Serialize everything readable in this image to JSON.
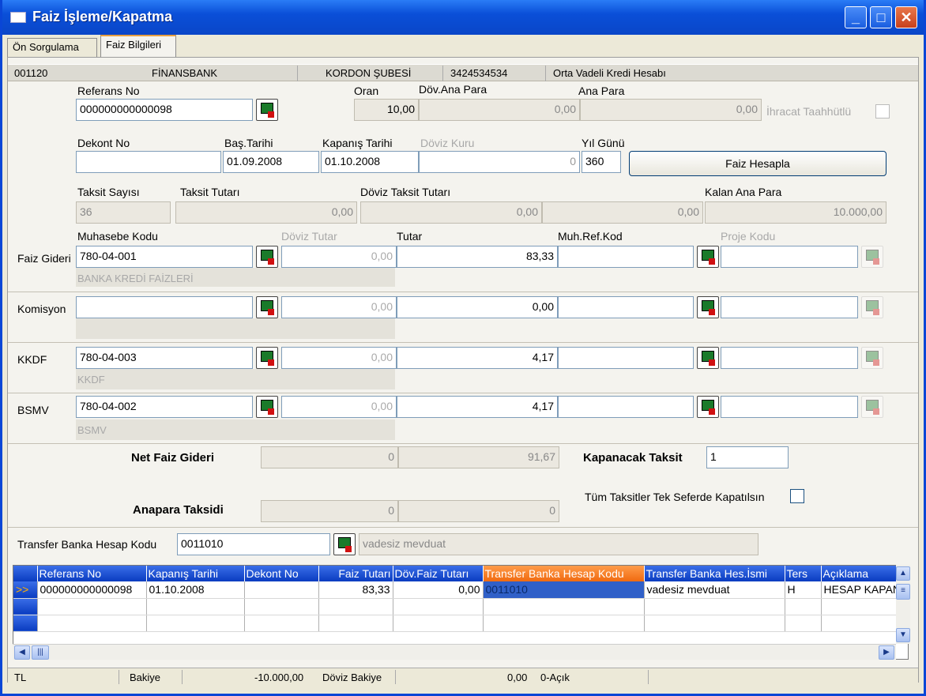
{
  "window": {
    "title": "Faiz İşleme/Kapatma"
  },
  "tabs": [
    "Ön Sorgulama",
    "Faiz Bilgileri"
  ],
  "info": {
    "code": "001120",
    "bank": "FİNANSBANK",
    "branch": "KORDON ŞUBESİ",
    "account": "3424534534",
    "account_type": "Orta Vadeli Kredi Hesabı"
  },
  "labels": {
    "referans_no": "Referans No",
    "oran": "Oran",
    "dov_ana_para": "Döv.Ana Para",
    "ana_para": "Ana Para",
    "ihracat": "İhracat Taahhütlü",
    "dekont_no": "Dekont No",
    "bas_tarihi": "Baş.Tarihi",
    "kapanis_tarihi": "Kapanış Tarihi",
    "doviz_kuru": "Döviz Kuru",
    "yil_gunu": "Yıl Günü",
    "taksit_sayisi": "Taksit Sayısı",
    "taksit_tutari": "Taksit Tutarı",
    "doviz_taksit_tutari": "Döviz Taksit Tutarı",
    "kalan_ana_para": "Kalan Ana Para",
    "muhasebe_kodu": "Muhasebe Kodu",
    "doviz_tutar": "Döviz Tutar",
    "tutar": "Tutar",
    "muh_ref_kod": "Muh.Ref.Kod",
    "proje_kodu": "Proje Kodu",
    "net_faiz_gideri": "Net Faiz Gideri",
    "kapanacak_taksit": "Kapanacak Taksit",
    "tum_taksitler": "Tüm Taksitler Tek Seferde Kapatılsın",
    "anapara_taksidi": "Anapara Taksidi",
    "transfer_banka_hesap_kodu": "Transfer Banka Hesap Kodu"
  },
  "fields": {
    "referans_no": "000000000000098",
    "oran": "10,00",
    "dov_ana_para": "0,00",
    "ana_para": "0,00",
    "dekont_no": "",
    "bas_tarihi": "01.09.2008",
    "kapanis_tarihi": "01.10.2008",
    "doviz_kuru": "0",
    "yil_gunu": "360",
    "taksit_sayisi": "36",
    "taksit_tutari": "0,00",
    "doviz_taksit_tutari": "0,00",
    "extra_tutari": "0,00",
    "kalan_ana_para": "10.000,00",
    "net_faiz_dov": "0",
    "net_faiz": "91,67",
    "kapanacak_taksit": "1",
    "anapara_dov": "0",
    "anapara": "0",
    "transfer_kodu": "0011010",
    "transfer_aciklama": "vadesiz mevduat"
  },
  "faiz_hesapla_button": "Faiz Hesapla",
  "rows": [
    {
      "label": "Faiz Gideri",
      "kod": "780-04-001",
      "doviz": "0,00",
      "tutar": "83,33",
      "desc": "BANKA KREDİ FAİZLERİ"
    },
    {
      "label": "Komisyon",
      "kod": "",
      "doviz": "0,00",
      "tutar": "0,00",
      "desc": ""
    },
    {
      "label": "KKDF",
      "kod": "780-04-003",
      "doviz": "0,00",
      "tutar": "4,17",
      "desc": "KKDF"
    },
    {
      "label": "BSMV",
      "kod": "780-04-002",
      "doviz": "0,00",
      "tutar": "4,17",
      "desc": "BSMV"
    }
  ],
  "grid": {
    "columns": [
      "Referans No",
      "Kapanış Tarihi",
      "Dekont No",
      "Faiz Tutarı",
      "Döv.Faiz Tutarı",
      "Transfer Banka Hesap Kodu",
      "Transfer Banka Hes.İsmi",
      "Ters",
      "Açıklama"
    ],
    "row": {
      "indicator": ">>",
      "referans": "000000000000098",
      "tarih": "01.10.2008",
      "dekont": "",
      "faiz": "83,33",
      "dov_faiz": "0,00",
      "transfer_kodu": "0011010",
      "transfer_ismi": "vadesiz mevduat",
      "ters": "H",
      "aciklama": "HESAP KAPAN"
    }
  },
  "status": {
    "currency": "TL",
    "bakiye_label": "Bakiye",
    "bakiye": "-10.000,00",
    "doviz_bakiye_label": "Döviz Bakiye",
    "doviz_bakiye": "0,00",
    "state": "0-Açık"
  },
  "icons": {
    "lookup": "lookup-icon",
    "minimize": "minimize-icon",
    "maximize": "maximize-icon",
    "close": "close-icon"
  }
}
